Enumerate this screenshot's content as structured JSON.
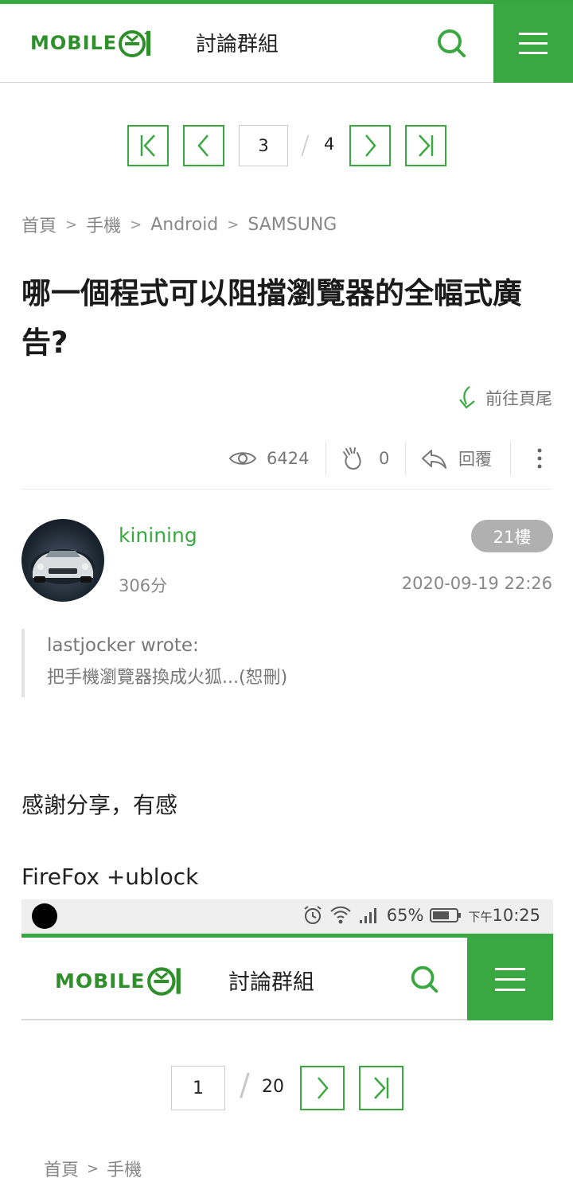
{
  "header": {
    "logo_text": "MOBILE",
    "title": "討論群組"
  },
  "pager": {
    "current": "3",
    "slash": "/",
    "total": "4"
  },
  "breadcrumb": {
    "items": [
      "首頁",
      "手機",
      "Android",
      "SAMSUNG"
    ],
    "separator": ">"
  },
  "thread": {
    "title": "哪一個程式可以阻擋瀏覽器的全幅式廣告?",
    "go_bottom_label": "前往頁尾",
    "views": "6424",
    "likes": "0",
    "reply_label": "回覆"
  },
  "post": {
    "username": "kinining",
    "score": "306分",
    "floor": "21樓",
    "datetime": "2020-09-19 22:26",
    "quote_author": "lastjocker wrote:",
    "quote_text": "把手機瀏覽器換成火狐...(恕刪)",
    "body_line1": "感謝分享，有感",
    "body_line2": "FireFox +ublock"
  },
  "embedded_screenshot": {
    "battery": "65%",
    "time": "10:25",
    "time_prefix": "下午",
    "logo_text": "MOBILE",
    "header_title": "討論群組",
    "pager_current": "1",
    "pager_slash": "/",
    "pager_total": "20",
    "breadcrumb": [
      "首頁",
      "手機"
    ],
    "separator": ">"
  },
  "colors": {
    "brand_green": "#3aa840",
    "muted_text": "#888888",
    "floor_badge": "#b0b0b0"
  }
}
